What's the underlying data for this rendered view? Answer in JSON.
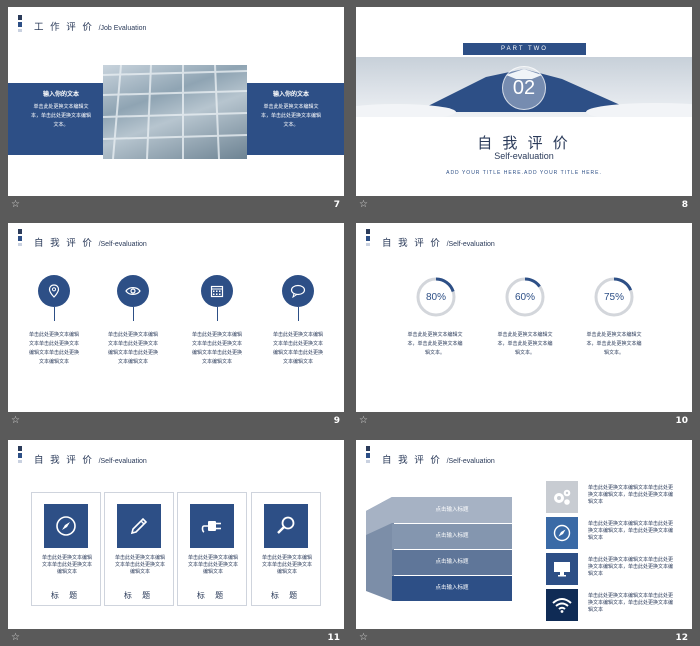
{
  "slides": [
    {
      "num": "7",
      "title": "工 作 评 价",
      "sub": "/Job Evaluation",
      "left_head": "输入你的文本",
      "right_head": "输入你的文本",
      "left_body": "单击此处更换文本编辑文本，单击此处更换文本编辑文本。",
      "right_body": "单击此处更换文本编辑文本，单击此处更换文本编辑文本。"
    },
    {
      "num": "8",
      "part": "PART TWO",
      "big": "02",
      "title": "自 我 评 价",
      "sub": "Self-evaluation",
      "add": "ADD YOUR TITLE HERE.ADD YOUR TITLE HERE."
    },
    {
      "num": "9",
      "title": "自 我 评 价",
      "sub": "/Self-evaluation",
      "body": "单击此处更换文本编辑文本单击此处更换文本编辑文本单击此处更换文本编辑文本"
    },
    {
      "num": "10",
      "title": "自 我 评 价",
      "sub": "/Self-evaluation",
      "rings": [
        {
          "label": "80%",
          "value": 80
        },
        {
          "label": "60%",
          "value": 60
        },
        {
          "label": "75%",
          "value": 75
        }
      ],
      "body": "单击此处更换文本编辑文本，单击此处更换文本编辑文本。"
    },
    {
      "num": "11",
      "title": "自 我 评 价",
      "sub": "/Self-evaluation",
      "cards": [
        "标 题",
        "标 题",
        "标 题",
        "标 题"
      ],
      "body": "单击此处更换文本编辑文本单击此处更换文本编辑文本"
    },
    {
      "num": "12",
      "title": "自 我 评 价",
      "sub": "/Self-evaluation",
      "layers": [
        "点击输入标题",
        "点击输入标题",
        "点击输入标题",
        "点击输入标题"
      ],
      "body": "单击此处更换文本编辑文本单击此处更换文本编辑文本，单击此处更换文本编辑文本"
    }
  ],
  "icons": {
    "s9": [
      "location-icon",
      "eye-icon",
      "calendar-icon",
      "chat-icon"
    ],
    "s11": [
      "compass-icon",
      "pencil-icon",
      "plug-icon",
      "magnifier-icon"
    ],
    "s12": [
      "gears-icon",
      "compass-icon",
      "monitor-icon",
      "wifi-icon"
    ]
  },
  "colors": {
    "accent": "#2d4f86",
    "bg": "#5a5a5a"
  }
}
